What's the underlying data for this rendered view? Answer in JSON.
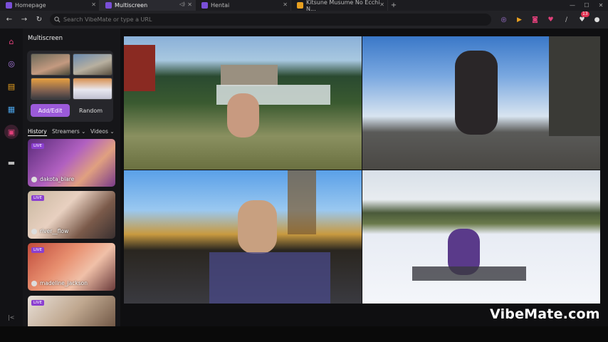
{
  "tabs": [
    {
      "label": "Homepage"
    },
    {
      "label": "Multiscreen"
    },
    {
      "label": "Hentai"
    },
    {
      "label": "Kitsune Musume No Ecchi N..."
    }
  ],
  "address": {
    "placeholder": "Search VibeMate or type a URL"
  },
  "toolbar": {
    "notification_count": "13"
  },
  "sidebar": {
    "title": "Multiscreen",
    "add_edit_label": "Add/Edit",
    "random_label": "Random",
    "filters": {
      "history": "History",
      "streamers": "Streamers",
      "videos": "Videos"
    },
    "live_label": "LIVE",
    "cards": [
      {
        "name": "dakota_blare"
      },
      {
        "name": "river__flow"
      },
      {
        "name": "madeline_jackson"
      },
      {
        "name": ""
      }
    ]
  },
  "watermark": "VibeMate.com",
  "colors": {
    "accent": "#9b5ad9",
    "live": "#8b3fd0"
  }
}
